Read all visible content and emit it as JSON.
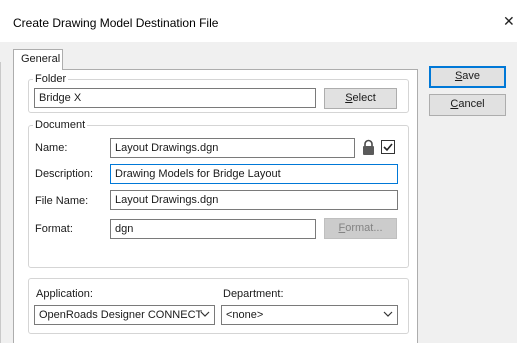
{
  "dialog": {
    "title": "Create Drawing Model Destination File",
    "close_glyph": "✕"
  },
  "tabs": [
    {
      "label": "General",
      "selected": true
    }
  ],
  "folder": {
    "legend": "Folder",
    "value": "Bridge X",
    "select_label_pre": "",
    "select_label_mnemonic": "S",
    "select_label_post": "elect"
  },
  "document": {
    "legend": "Document",
    "name_label": "Name:",
    "name_value": "Layout Drawings.dgn",
    "name_locked": true,
    "name_lock_icon": "lock-icon",
    "name_checked": true,
    "description_label": "Description:",
    "description_value": "Drawing Models for Bridge Layout",
    "file_name_label": "File Name:",
    "file_name_value": "Layout Drawings.dgn",
    "format_label": "Format:",
    "format_value": "dgn",
    "format_button_mnemonic": "F",
    "format_button_post": "ormat...",
    "format_button_enabled": false
  },
  "application": {
    "label": "Application:",
    "value": "OpenRoads Designer CONNECT"
  },
  "department": {
    "label": "Department:",
    "value": "<none>"
  },
  "buttons": {
    "save_mnemonic": "S",
    "save_post": "ave",
    "cancel_mnemonic": "C",
    "cancel_post": "ancel"
  },
  "colors": {
    "accent": "#0078d7",
    "dialog_bg": "#f0f0f0",
    "button_bg": "#e1e1e1",
    "disabled_bg": "#cccccc"
  }
}
